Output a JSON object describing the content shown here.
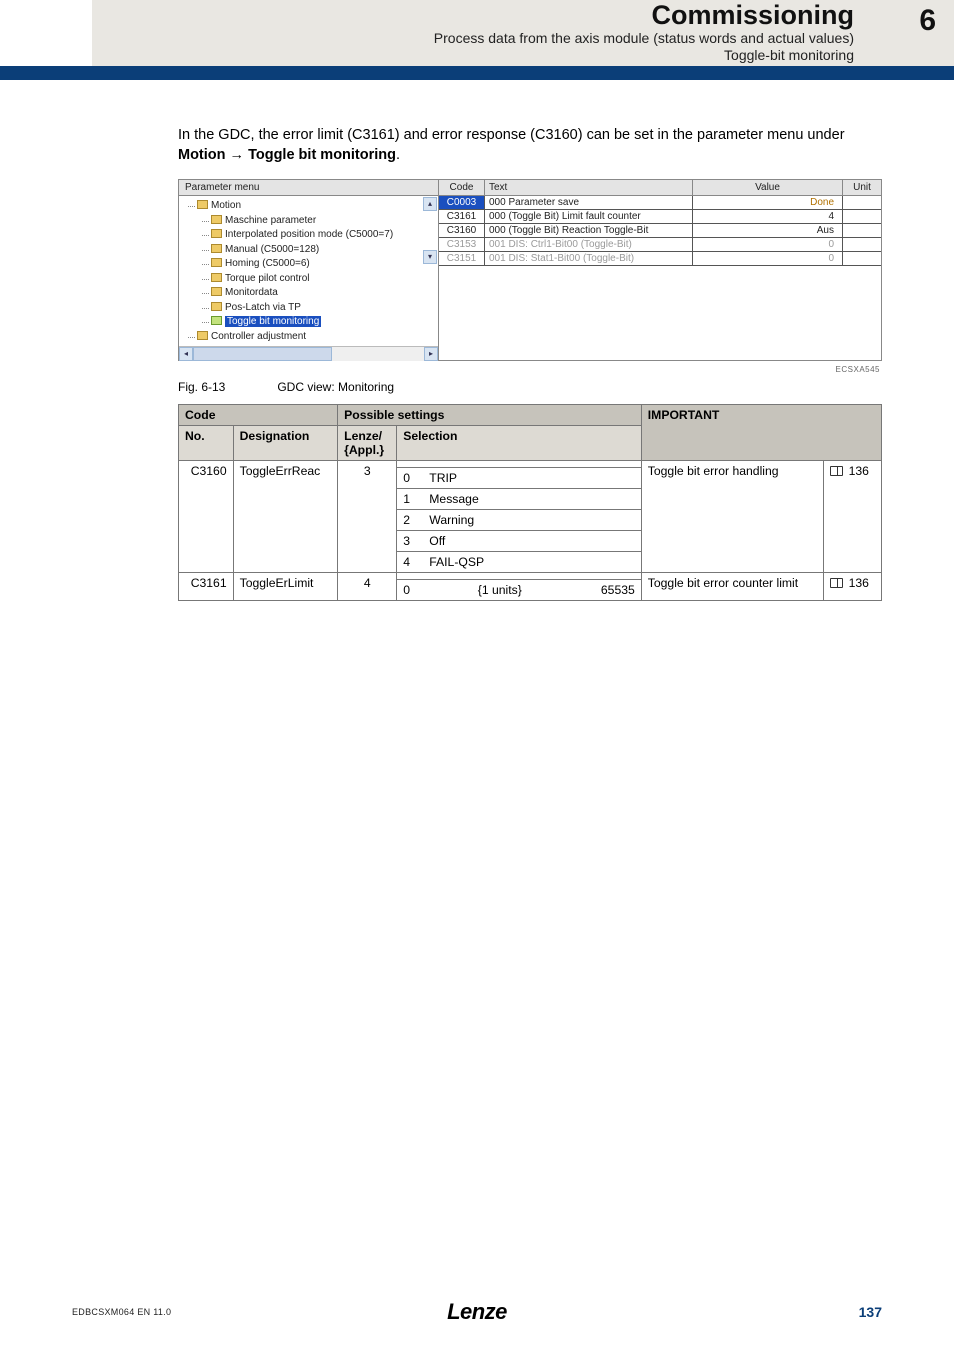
{
  "header": {
    "title": "Commissioning",
    "subtitle1": "Process data from the axis module (status words and actual values)",
    "subtitle2": "Toggle-bit monitoring",
    "chapter": "6"
  },
  "intro": {
    "line1": "In the GDC, the error limit (C3161) and error response (C3160) can be set in the parameter menu under ",
    "bold1": "Motion",
    "arrow": " → ",
    "bold2": "Toggle bit monitoring",
    "period": "."
  },
  "gdc": {
    "panel_title": "Parameter menu",
    "tree": {
      "root": "Motion",
      "items": [
        "Maschine parameter",
        "Interpolated position mode (C5000=7)",
        "Manual (C5000=128)",
        "Homing (C5000=6)",
        "Torque pilot control",
        "Monitordata",
        "Pos-Latch via TP",
        "Toggle bit monitoring"
      ],
      "after": "Controller adjustment",
      "selected_index": 7
    },
    "cols": {
      "code": "Code",
      "text": "Text",
      "value": "Value",
      "unit": "Unit"
    },
    "rows": [
      {
        "code": "C0003",
        "text": "000  Parameter save",
        "value": "Done",
        "hl": true
      },
      {
        "code": "C3161",
        "text": "000  (Toggle Bit)  Limit fault counter",
        "value": "4"
      },
      {
        "code": "C3160",
        "text": "000  (Toggle Bit)  Reaction  Toggle-Bit",
        "value": "Aus"
      },
      {
        "code": "C3153",
        "text": "001  DIS: Ctrl1-Bit00 (Toggle-Bit)",
        "value": "0",
        "dis": true
      },
      {
        "code": "C3151",
        "text": "001  DIS: Stat1-Bit00 (Toggle-Bit)",
        "value": "0",
        "dis": true
      }
    ],
    "ecsx": "ECSXA545"
  },
  "figure": {
    "num": "Fig. 6-13",
    "caption": "GDC view: Monitoring"
  },
  "table": {
    "head": {
      "code": "Code",
      "possible": "Possible settings",
      "important": "IMPORTANT",
      "no": "No.",
      "designation": "Designation",
      "lenze": "Lenze/\n{Appl.}",
      "selection": "Selection"
    },
    "rows": [
      {
        "no": "C3160",
        "designation": "ToggleErrReac",
        "lenze": "3",
        "selections": [
          {
            "n": "0",
            "label": "TRIP"
          },
          {
            "n": "1",
            "label": "Message"
          },
          {
            "n": "2",
            "label": "Warning"
          },
          {
            "n": "3",
            "label": "Off"
          },
          {
            "n": "4",
            "label": "FAIL-QSP"
          }
        ],
        "important": "Toggle bit error handling",
        "page": "136"
      },
      {
        "no": "C3161",
        "designation": "ToggleErLimit",
        "lenze": "4",
        "range": {
          "n": "0",
          "units": "{1 units}",
          "max": "65535"
        },
        "important": "Toggle bit error counter limit",
        "page": "136"
      }
    ]
  },
  "footer": {
    "left": "EDBCSXM064  EN  11.0",
    "brand": "Lenze",
    "page": "137"
  }
}
